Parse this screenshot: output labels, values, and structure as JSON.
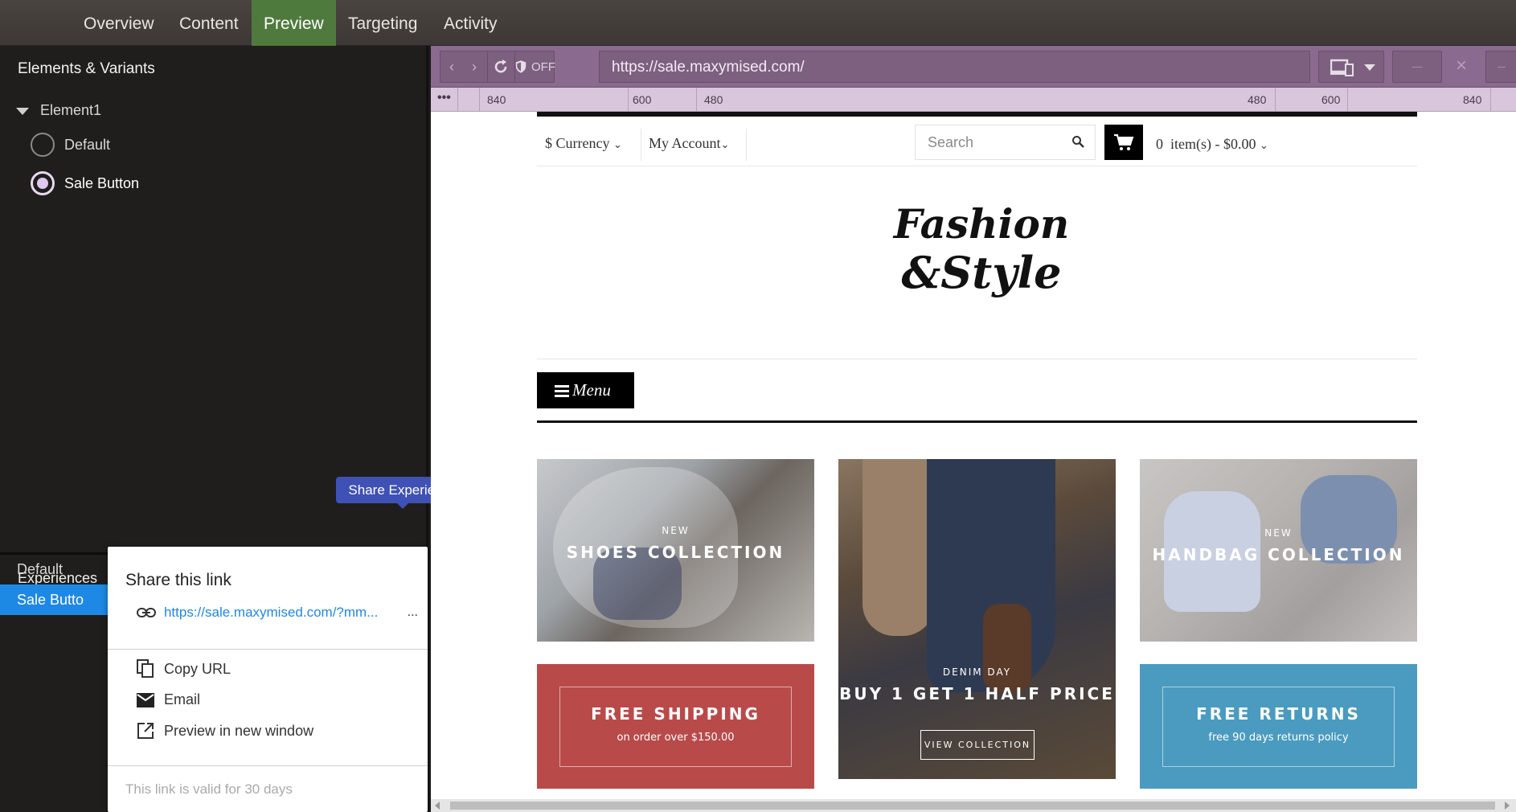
{
  "topnav": {
    "tabs": [
      {
        "label": "Overview"
      },
      {
        "label": "Content"
      },
      {
        "label": "Preview"
      },
      {
        "label": "Targeting"
      },
      {
        "label": "Activity"
      }
    ]
  },
  "left_panel": {
    "title": "Elements & Variants",
    "element": "Element1",
    "variants": [
      {
        "label": "Default",
        "selected": false
      },
      {
        "label": "Sale Button",
        "selected": true
      }
    ]
  },
  "experiences": {
    "title": "Experiences",
    "items": [
      {
        "label": "Default"
      },
      {
        "label": "Sale Butto"
      }
    ],
    "tooltip": "Share Experience"
  },
  "share_popup": {
    "title": "Share this link",
    "link": "https://sale.maxymised.com/?mm...",
    "more": "...",
    "actions": [
      {
        "label": "Copy URL",
        "icon": "copy-icon"
      },
      {
        "label": "Email",
        "icon": "email-icon"
      },
      {
        "label": "Preview in new window",
        "icon": "open-new-window-icon"
      }
    ],
    "validity": "This link is valid for 30 days"
  },
  "browser": {
    "protection": "OFF",
    "url": "https://sale.maxymised.com/"
  },
  "ruler": {
    "dots": "•••",
    "labels": [
      "840",
      "600",
      "480",
      "480",
      "600",
      "840"
    ]
  },
  "site": {
    "currency": "$ Currency",
    "account": "My Account",
    "search_placeholder": "Search",
    "cart": "0  item(s) - $0.00",
    "menu": "Menu",
    "logo_line1": "Fashion",
    "logo_line2": "&Style",
    "banners": {
      "shoes_small": "NEW",
      "shoes_big": "SHOES COLLECTION",
      "denim_small": "DENIM DAY",
      "denim_big": "BUY 1 GET 1 HALF PRICE",
      "denim_btn": "VIEW COLLECTION",
      "handbag_small": "NEW",
      "handbag_big": "HANDBAG COLLECTION",
      "shipping_big": "FREE SHIPPING",
      "shipping_small": "on order over $150.00",
      "returns_big": "FREE RETURNS",
      "returns_small": "free 90 days returns policy"
    }
  },
  "colors": {
    "preview_tab": "#4f7a3d",
    "selected_experience": "#1e88e5",
    "tooltip": "#3f51b5",
    "browser_bar": "#8a6a8e",
    "shipping_banner": "#b94a4a",
    "returns_banner": "#4a9bbf"
  }
}
